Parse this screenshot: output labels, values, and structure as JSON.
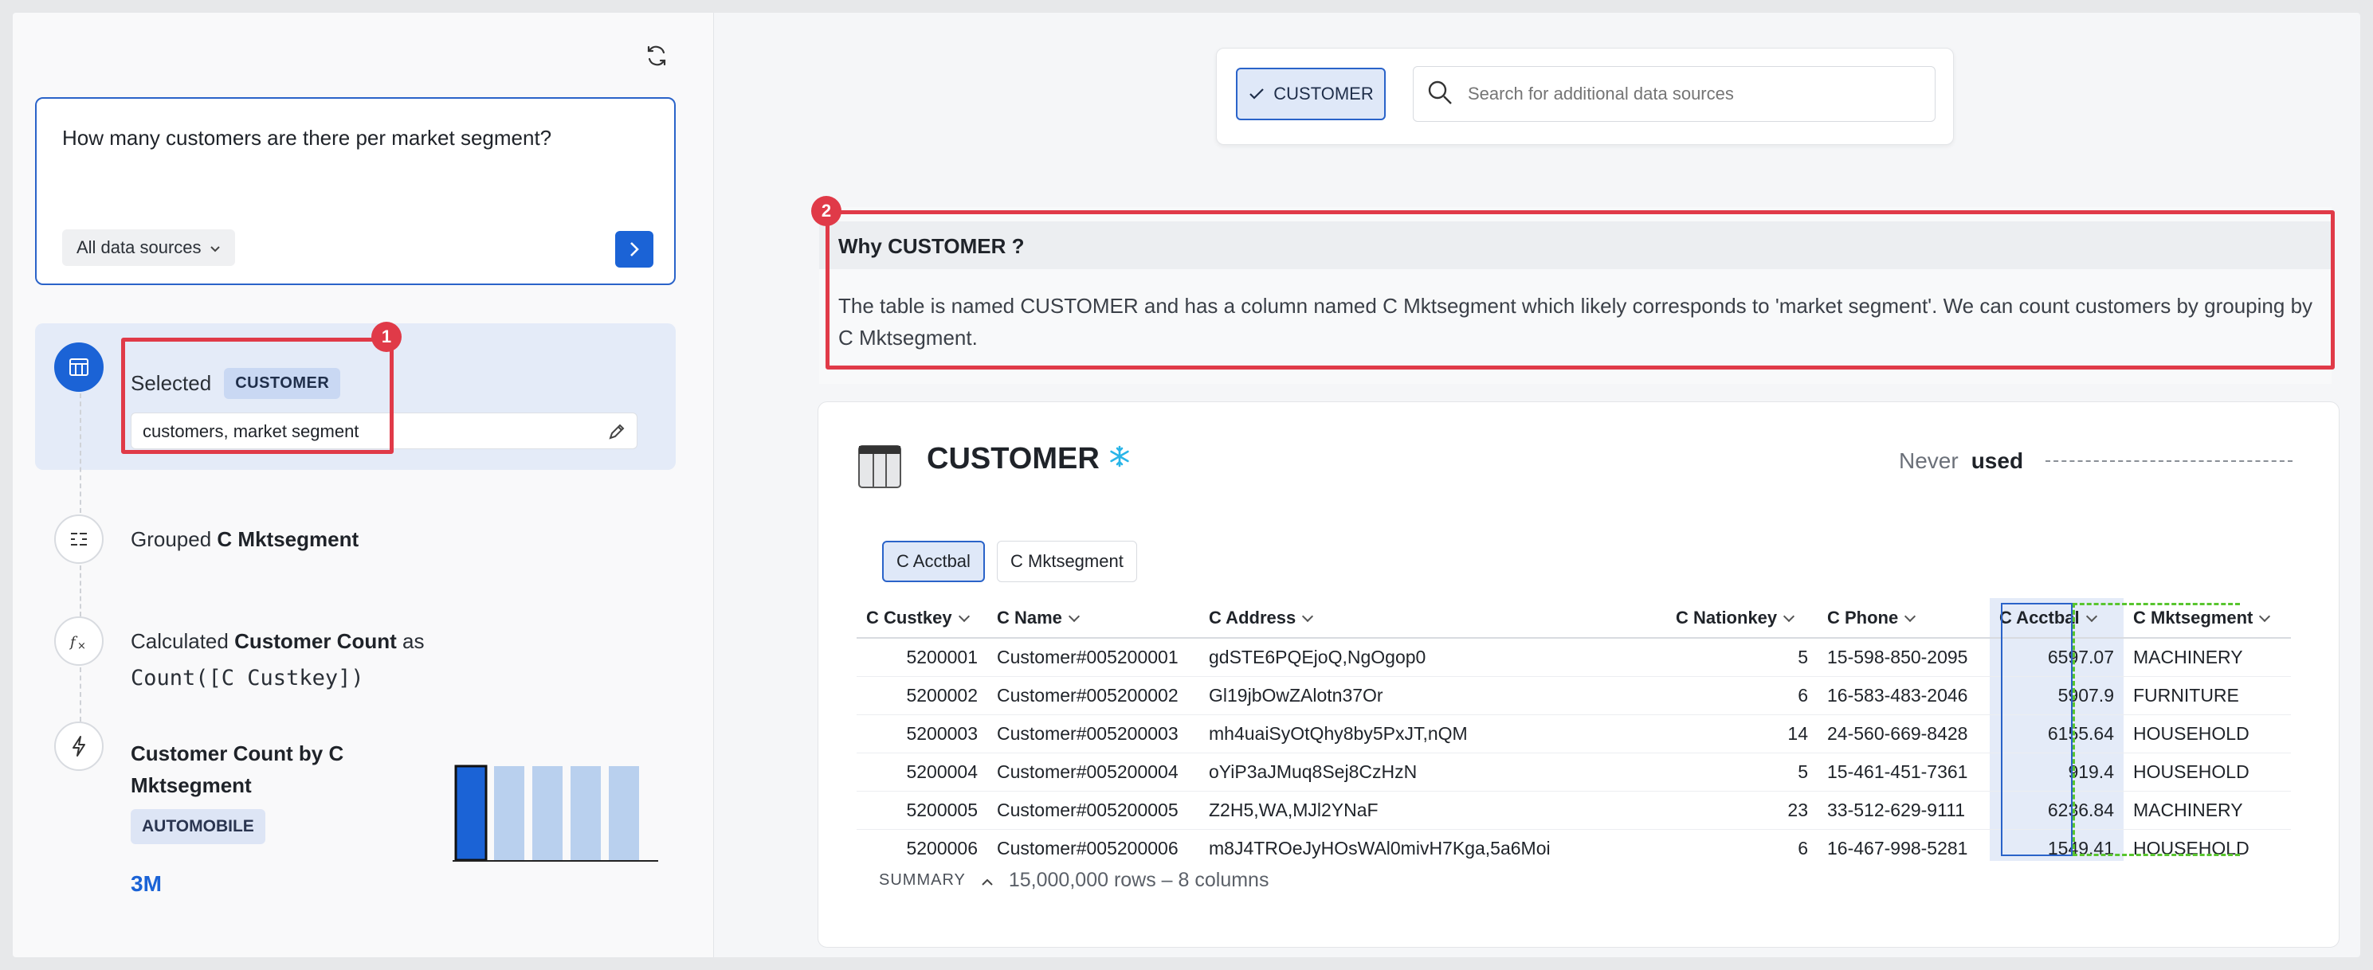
{
  "left": {
    "question": "How many customers are there per market segment?",
    "source_button": "All data sources",
    "selected": {
      "label": "Selected",
      "chip": "CUSTOMER",
      "input_value": "customers, market segment"
    },
    "grouped": {
      "label": "Grouped",
      "value": "C Mktsegment"
    },
    "calculated": {
      "label": "Calculated",
      "value": "Customer Count",
      "as": "as",
      "formula": "Count([C Custkey])"
    },
    "result": {
      "title": "Customer Count by C Mktsegment",
      "chip": "AUTOMOBILE",
      "value": "3M",
      "bar_values": [
        3,
        3,
        3,
        3,
        3
      ],
      "highlight_index": 0
    }
  },
  "annotations": {
    "badge1": "1",
    "badge2": "2"
  },
  "topbar": {
    "selected_source": "CUSTOMER",
    "search_placeholder": "Search for additional data sources"
  },
  "why": {
    "title": "Why CUSTOMER ?",
    "body": "The table is named CUSTOMER and has a column named C Mktsegment which likely corresponds to 'market segment'. We can count customers by grouping by C Mktsegment."
  },
  "table": {
    "title": "CUSTOMER",
    "usage_prefix": "Never",
    "usage_suffix": "used",
    "column_chips": [
      "C Acctbal",
      "C Mktsegment"
    ],
    "headers": [
      "C Custkey",
      "C Name",
      "C Address",
      "C Nationkey",
      "C Phone",
      "C Acctbal",
      "C Mktsegment"
    ],
    "rows": [
      [
        "5200001",
        "Customer#005200001",
        "gdSTE6PQEjoQ,NgOgop0",
        "5",
        "15-598-850-2095",
        "6597.07",
        "MACHINERY"
      ],
      [
        "5200002",
        "Customer#005200002",
        "Gl19jbOwZAlotn37Or",
        "6",
        "16-583-483-2046",
        "5907.9",
        "FURNITURE"
      ],
      [
        "5200003",
        "Customer#005200003",
        "mh4uaiSyOtQhy8by5PxJT,nQM",
        "14",
        "24-560-669-8428",
        "6155.64",
        "HOUSEHOLD"
      ],
      [
        "5200004",
        "Customer#005200004",
        "oYiP3aJMuq8Sej8CzHzN",
        "5",
        "15-461-451-7361",
        "919.4",
        "HOUSEHOLD"
      ],
      [
        "5200005",
        "Customer#005200005",
        "Z2H5,WA,MJl2YNaF",
        "23",
        "33-512-629-9111",
        "6236.84",
        "MACHINERY"
      ],
      [
        "5200006",
        "Customer#005200006",
        "m8J4TROeJyHOsWAl0mivH7Kga,5a6Moi",
        "6",
        "16-467-998-5281",
        "1549.41",
        "HOUSEHOLD"
      ]
    ],
    "summary_label": "SUMMARY",
    "summary_count": "15,000,000 rows – 8 columns"
  },
  "colors": {
    "accent": "#1b63d6",
    "highlight_red": "#e03a48",
    "snowflake": "#29b5e8",
    "dashed_green": "#58c52e"
  }
}
